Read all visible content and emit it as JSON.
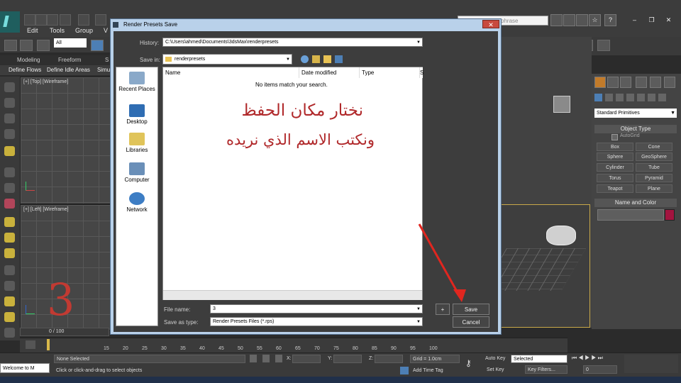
{
  "menu": [
    "Edit",
    "Tools",
    "Group",
    "V"
  ],
  "filter_value": "All",
  "search_placeholder": "phrase",
  "ribbon": {
    "tabs": [
      "Modeling",
      "Freeform",
      "S"
    ],
    "buttons": [
      "Define Flows",
      "Define Idle Areas",
      "Simu"
    ]
  },
  "viewports": {
    "top_label": "[+] [Top] [Wireframe]",
    "left_label": "[+] [Left] [Wireframe]"
  },
  "dialog": {
    "title": "Render Presets Save",
    "history_label": "History:",
    "history_value": "C:\\Users\\ahmed\\Documents\\3dsMax\\renderpresets",
    "save_in_label": "Save in:",
    "save_in_value": "renderpresets",
    "places": [
      "Recent Places",
      "Desktop",
      "Libraries",
      "Computer",
      "Network"
    ],
    "columns": [
      "Name",
      "Date modified",
      "Type",
      "S"
    ],
    "empty_message": "No items match your search.",
    "file_name_label": "File name:",
    "file_name_value": "3",
    "save_type_label": "Save as type:",
    "save_type_value": "Render Presets Files (*.rps)",
    "plus_label": "+",
    "save_button": "Save",
    "cancel_button": "Cancel"
  },
  "annotation": {
    "line1": "نختار مكان الحفظ",
    "line2": "ونكتب الاسم الذي نريده",
    "step_number": "3"
  },
  "command_panel": {
    "category": "Standard Primitives",
    "object_type_title": "Object Type",
    "autogrid": "AutoGrid",
    "objects": [
      "Box",
      "Cone",
      "Sphere",
      "GeoSphere",
      "Cylinder",
      "Tube",
      "Torus",
      "Pyramid",
      "Teapot",
      "Plane"
    ],
    "name_color_title": "Name and Color"
  },
  "timeline": {
    "frame_counter": "0 / 100",
    "ticks": [
      "15",
      "20",
      "25",
      "30",
      "35",
      "40",
      "45",
      "50",
      "55",
      "60",
      "65",
      "70",
      "75",
      "80",
      "85",
      "90",
      "95",
      "100"
    ]
  },
  "status": {
    "welcome": "Welcome to M",
    "selection": "None Selected",
    "prompt": "Click or click-and-drag to select objects",
    "x_label": "X:",
    "y_label": "Y:",
    "z_label": "Z:",
    "grid": "Grid = 1.0cm",
    "add_time_tag": "Add Time Tag",
    "auto_key": "Auto Key",
    "set_key": "Set Key",
    "selected": "Selected",
    "key_filters": "Key Filters...",
    "frame": "0"
  },
  "colors": {
    "annotation": "#b0282a",
    "swatch": "#a3133f"
  }
}
